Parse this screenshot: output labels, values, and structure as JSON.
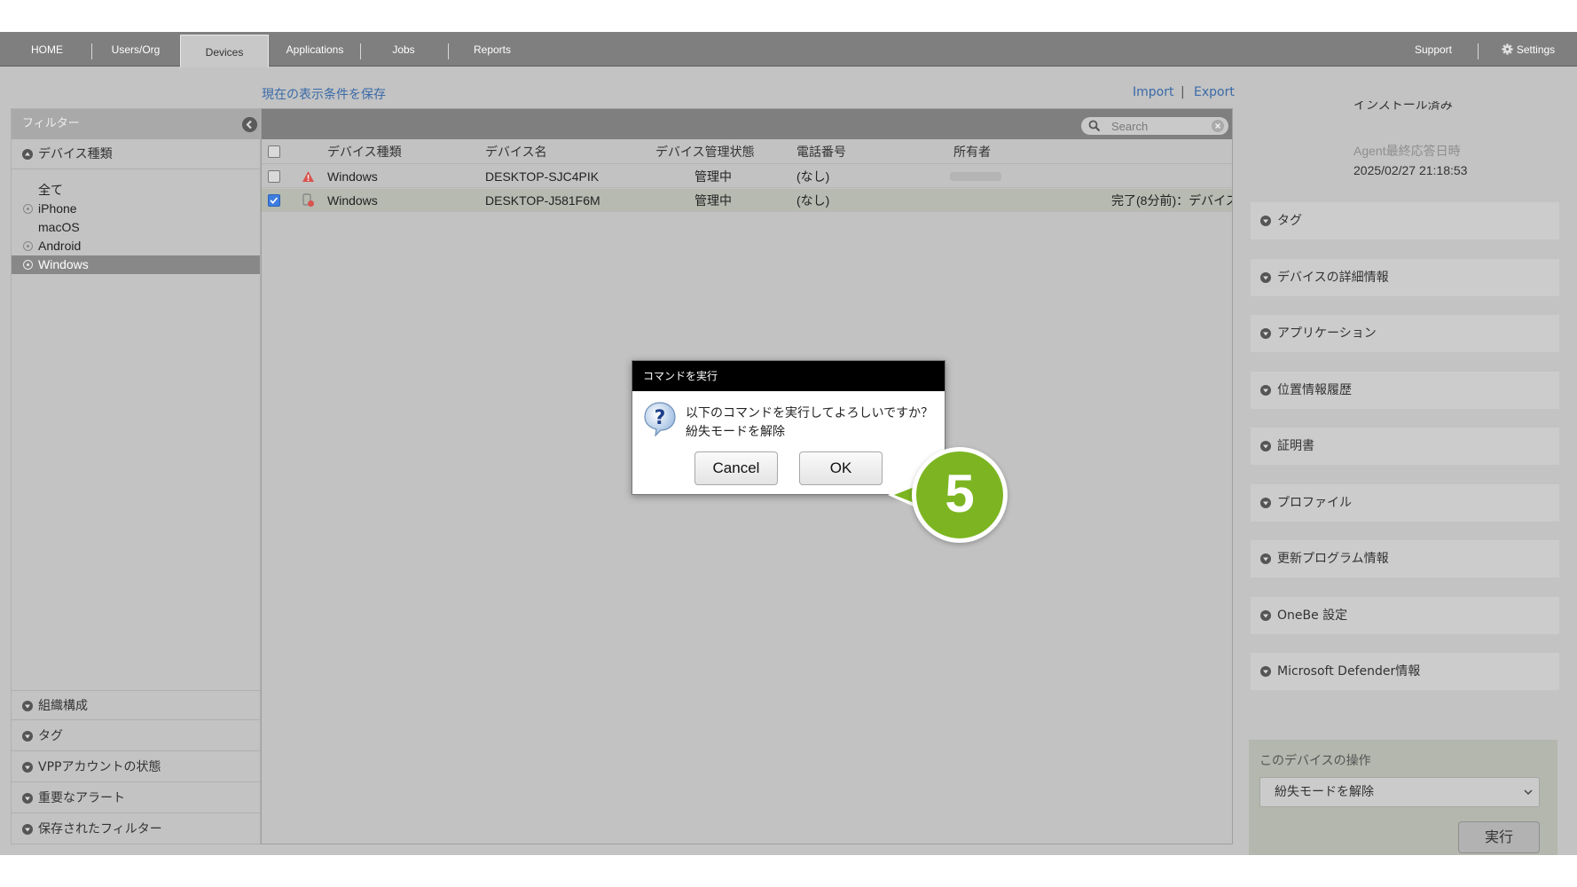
{
  "nav": {
    "tabs": [
      "HOME",
      "Users/Org",
      "Devices",
      "Applications",
      "Jobs",
      "Reports"
    ],
    "support": "Support",
    "settings": "Settings"
  },
  "toolbar": {
    "save_view": "現在の表示条件を保存",
    "import": "Import",
    "separator": "|",
    "export": "Export"
  },
  "sidebar": {
    "header": "フィルター",
    "device_type": "デバイス種類",
    "items": [
      "全て",
      "iPhone",
      "macOS",
      "Android",
      "Windows"
    ],
    "selected": "Windows",
    "sections": [
      "組織構成",
      "タグ",
      "VPPアカウントの状態",
      "重要なアラート",
      "保存されたフィルター"
    ]
  },
  "table": {
    "search_placeholder": "Search",
    "columns": [
      "デバイス種類",
      "デバイス名",
      "デバイス管理状態",
      "電話番号",
      "所有者"
    ],
    "rows": [
      {
        "type": "Windows",
        "name": "DESKTOP-SJC4PIK",
        "status": "管理中",
        "phone": "(なし)",
        "extra": "",
        "checked": false
      },
      {
        "type": "Windows",
        "name": "DESKTOP-J581F6M",
        "status": "管理中",
        "phone": "(なし)",
        "extra": "完了(8分前)：デバイス",
        "checked": true
      }
    ]
  },
  "detail": {
    "installed": "インストール済み",
    "agent_label": "Agent最終応答日時",
    "agent_value": "2025/02/27 21:18:53",
    "sections": [
      "タグ",
      "デバイスの詳細情報",
      "アプリケーション",
      "位置情報履歴",
      "証明書",
      "プロファイル",
      "更新プログラム情報",
      "OneBe 設定",
      "Microsoft Defender情報"
    ],
    "ops_title": "このデバイスの操作",
    "ops_selected": "紛失モードを解除",
    "run": "実行"
  },
  "dialog": {
    "title": "コマンドを実行",
    "line1": "以下のコマンドを実行してよろしいですか？",
    "line2": "紛失モードを解除",
    "cancel": "Cancel",
    "ok": "OK"
  },
  "step_badge": "5",
  "colors": {
    "accent_green": "#7cb521",
    "link_blue": "#3a6aa8",
    "checkbox_blue": "#3d7de0"
  }
}
